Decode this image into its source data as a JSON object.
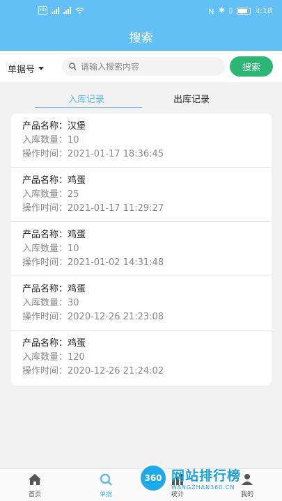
{
  "status_bar": {
    "time": "3:18"
  },
  "header": {
    "title": "搜索"
  },
  "search": {
    "type_label": "单据号",
    "placeholder": "请输入搜索内容",
    "button_label": "搜索"
  },
  "tabs": [
    {
      "label": "入库记录",
      "active": true
    },
    {
      "label": "出库记录",
      "active": false
    }
  ],
  "records": [
    {
      "name_label": "产品名称：",
      "name": "汉堡",
      "qty_label": "入库数量：",
      "qty": "10",
      "time_label": "操作时间：",
      "time": "2021-01-17 18:36:45"
    },
    {
      "name_label": "产品名称：",
      "name": "鸡蛋",
      "qty_label": "入库数量：",
      "qty": "25",
      "time_label": "操作时间：",
      "time": "2021-01-17 11:29:27"
    },
    {
      "name_label": "产品名称：",
      "name": "鸡蛋",
      "qty_label": "入库数量：",
      "qty": "10",
      "time_label": "操作时间：",
      "time": "2021-01-02 14:31:48"
    },
    {
      "name_label": "产品名称：",
      "name": "鸡蛋",
      "qty_label": "入库数量：",
      "qty": "30",
      "time_label": "操作时间：",
      "time": "2020-12-26 21:23:08"
    },
    {
      "name_label": "产品名称：",
      "name": "鸡蛋",
      "qty_label": "入库数量：",
      "qty": "120",
      "time_label": "操作时间：",
      "time": "2020-12-26 21:24:02"
    }
  ],
  "bottom_nav": [
    {
      "label": "首页",
      "icon": "home-icon"
    },
    {
      "label": "单据",
      "icon": "search-icon",
      "active": true
    },
    {
      "label": "统计",
      "icon": "stats-icon"
    },
    {
      "label": "我的",
      "icon": "user-icon"
    }
  ],
  "watermark": {
    "logo": "360",
    "title": "网站排行榜",
    "subtitle": "WANGZHAN360.CN"
  },
  "colors": {
    "header": "#62c0f5",
    "accent": "#5ab8ee",
    "search_button": "#2bb673"
  }
}
